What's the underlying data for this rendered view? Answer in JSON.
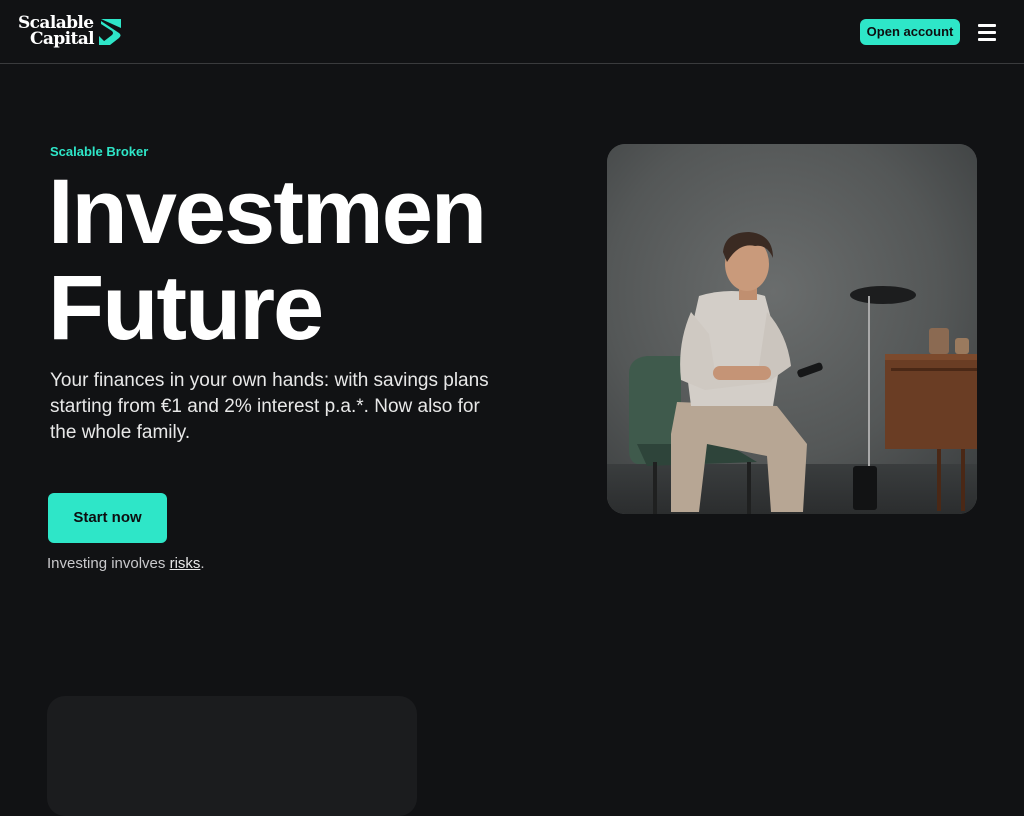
{
  "header": {
    "logo": {
      "line1": "Scalable",
      "line2": "Capital"
    },
    "open_account_label": "Open account",
    "menu_icon": "hamburger-menu-icon"
  },
  "hero": {
    "eyebrow": "Scalable Broker",
    "headline_line1": "Investmen",
    "headline_line2": "Future",
    "lead": "Your finances in your own hands: with savings plans starting from €1 and 2% interest p.a.*. Now also for the whole family.",
    "cta_label": "Start now",
    "risk_prefix": "Investing involves ",
    "risk_link": "risks",
    "risk_suffix": "."
  },
  "colors": {
    "background": "#111214",
    "accent": "#2ee6c8",
    "text": "#ffffff"
  }
}
